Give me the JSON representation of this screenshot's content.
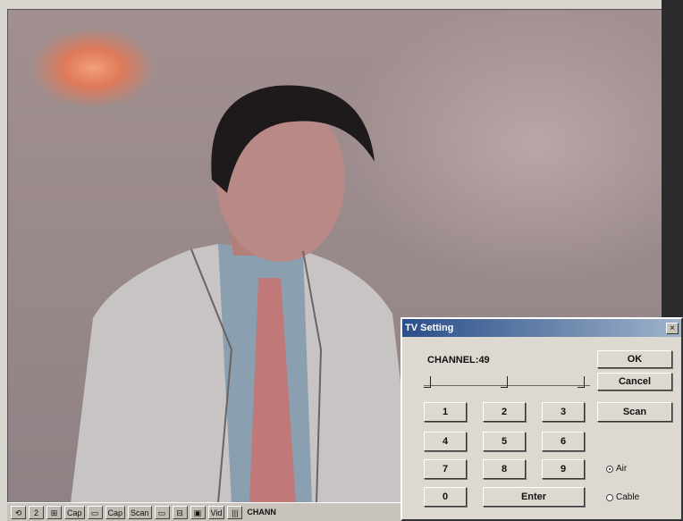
{
  "dialog": {
    "title": "TV Setting",
    "close_glyph": "×",
    "channel_label": "CHANNEL:49",
    "buttons": {
      "ok": "OK",
      "cancel": "Cancel",
      "scan": "Scan",
      "enter": "Enter"
    },
    "keypad": [
      "1",
      "2",
      "3",
      "4",
      "5",
      "6",
      "7",
      "8",
      "9",
      "0"
    ],
    "radios": [
      {
        "label": "Air",
        "selected": true
      },
      {
        "label": "Cable",
        "selected": false
      }
    ]
  },
  "toolbar": {
    "channel_label": "CHANN",
    "buttons": [
      "⟲",
      "2",
      "⊞",
      "Cap",
      "▭",
      "Cap",
      "Scan",
      "▭",
      "⊟",
      "▣",
      "Vid",
      "|||"
    ]
  },
  "colors": {
    "title_start": "#2a4e8a",
    "dialog_face": "#ddd9d1",
    "video_bg": "#9b8a8b"
  }
}
